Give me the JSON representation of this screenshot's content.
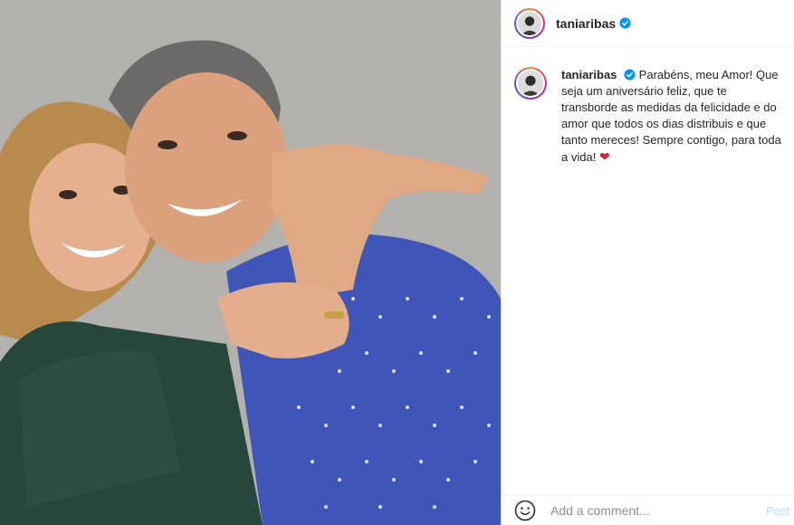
{
  "post": {
    "username": "taniaribas",
    "verified": true,
    "caption": "Parabéns, meu Amor! Que seja um aniversário feliz, que te transborde as medidas da felicidade e do amor que todos os dias distribuis e que tanto mereces! Sempre contigo, para toda a vida!",
    "caption_emoji": "❤"
  },
  "add_comment": {
    "placeholder": "Add a comment...",
    "post_label": "Post"
  },
  "icons": {
    "verified": "verified-badge-icon",
    "emoji": "emoji-smiley-icon"
  },
  "colors": {
    "accent_blue": "#0095f6",
    "post_disabled": "#b2dffc",
    "heart": "#d81c33"
  }
}
